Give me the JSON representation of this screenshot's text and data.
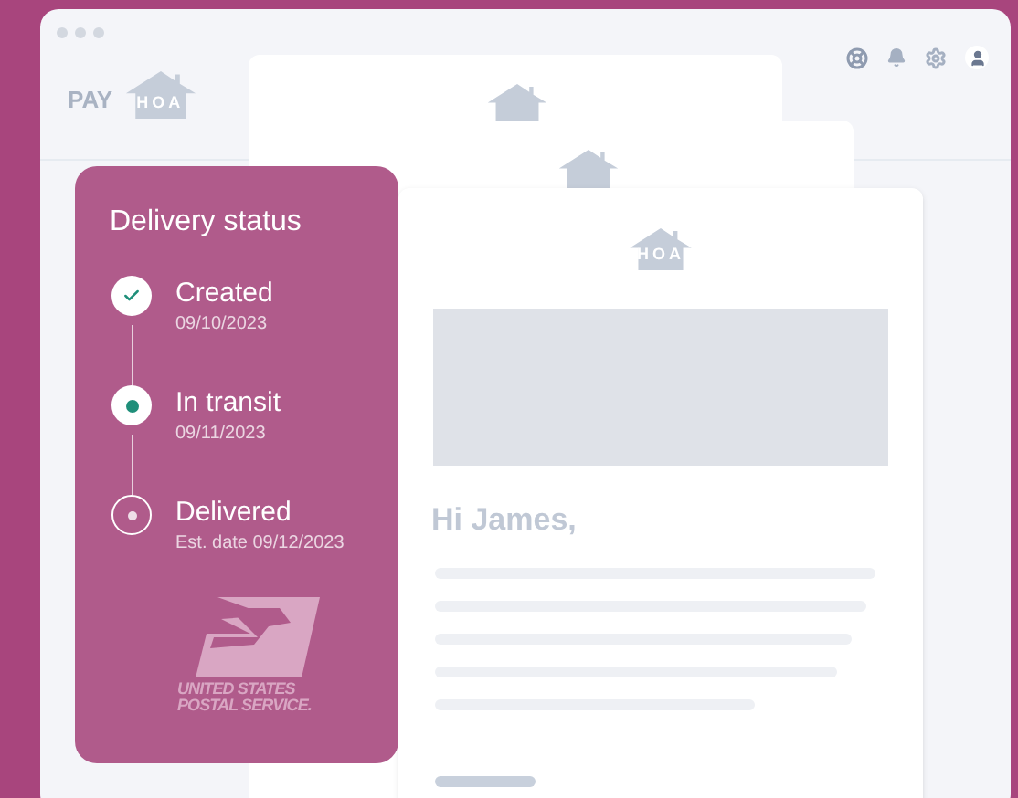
{
  "header": {
    "logo_prefix": "PAY",
    "logo_mark": "HOA"
  },
  "delivery": {
    "title": "Delivery status",
    "steps": [
      {
        "label": "Created",
        "date": "09/10/2023",
        "kind": "done"
      },
      {
        "label": "In transit",
        "date": "09/11/2023",
        "kind": "current"
      },
      {
        "label": "Delivered",
        "date": "Est. date 09/12/2023",
        "kind": "pending"
      }
    ],
    "carrier_lines": [
      "UNITED STATES",
      "POSTAL SERVICE."
    ]
  },
  "email": {
    "logo_mark": "HOA",
    "greeting": "Hi James,"
  }
}
